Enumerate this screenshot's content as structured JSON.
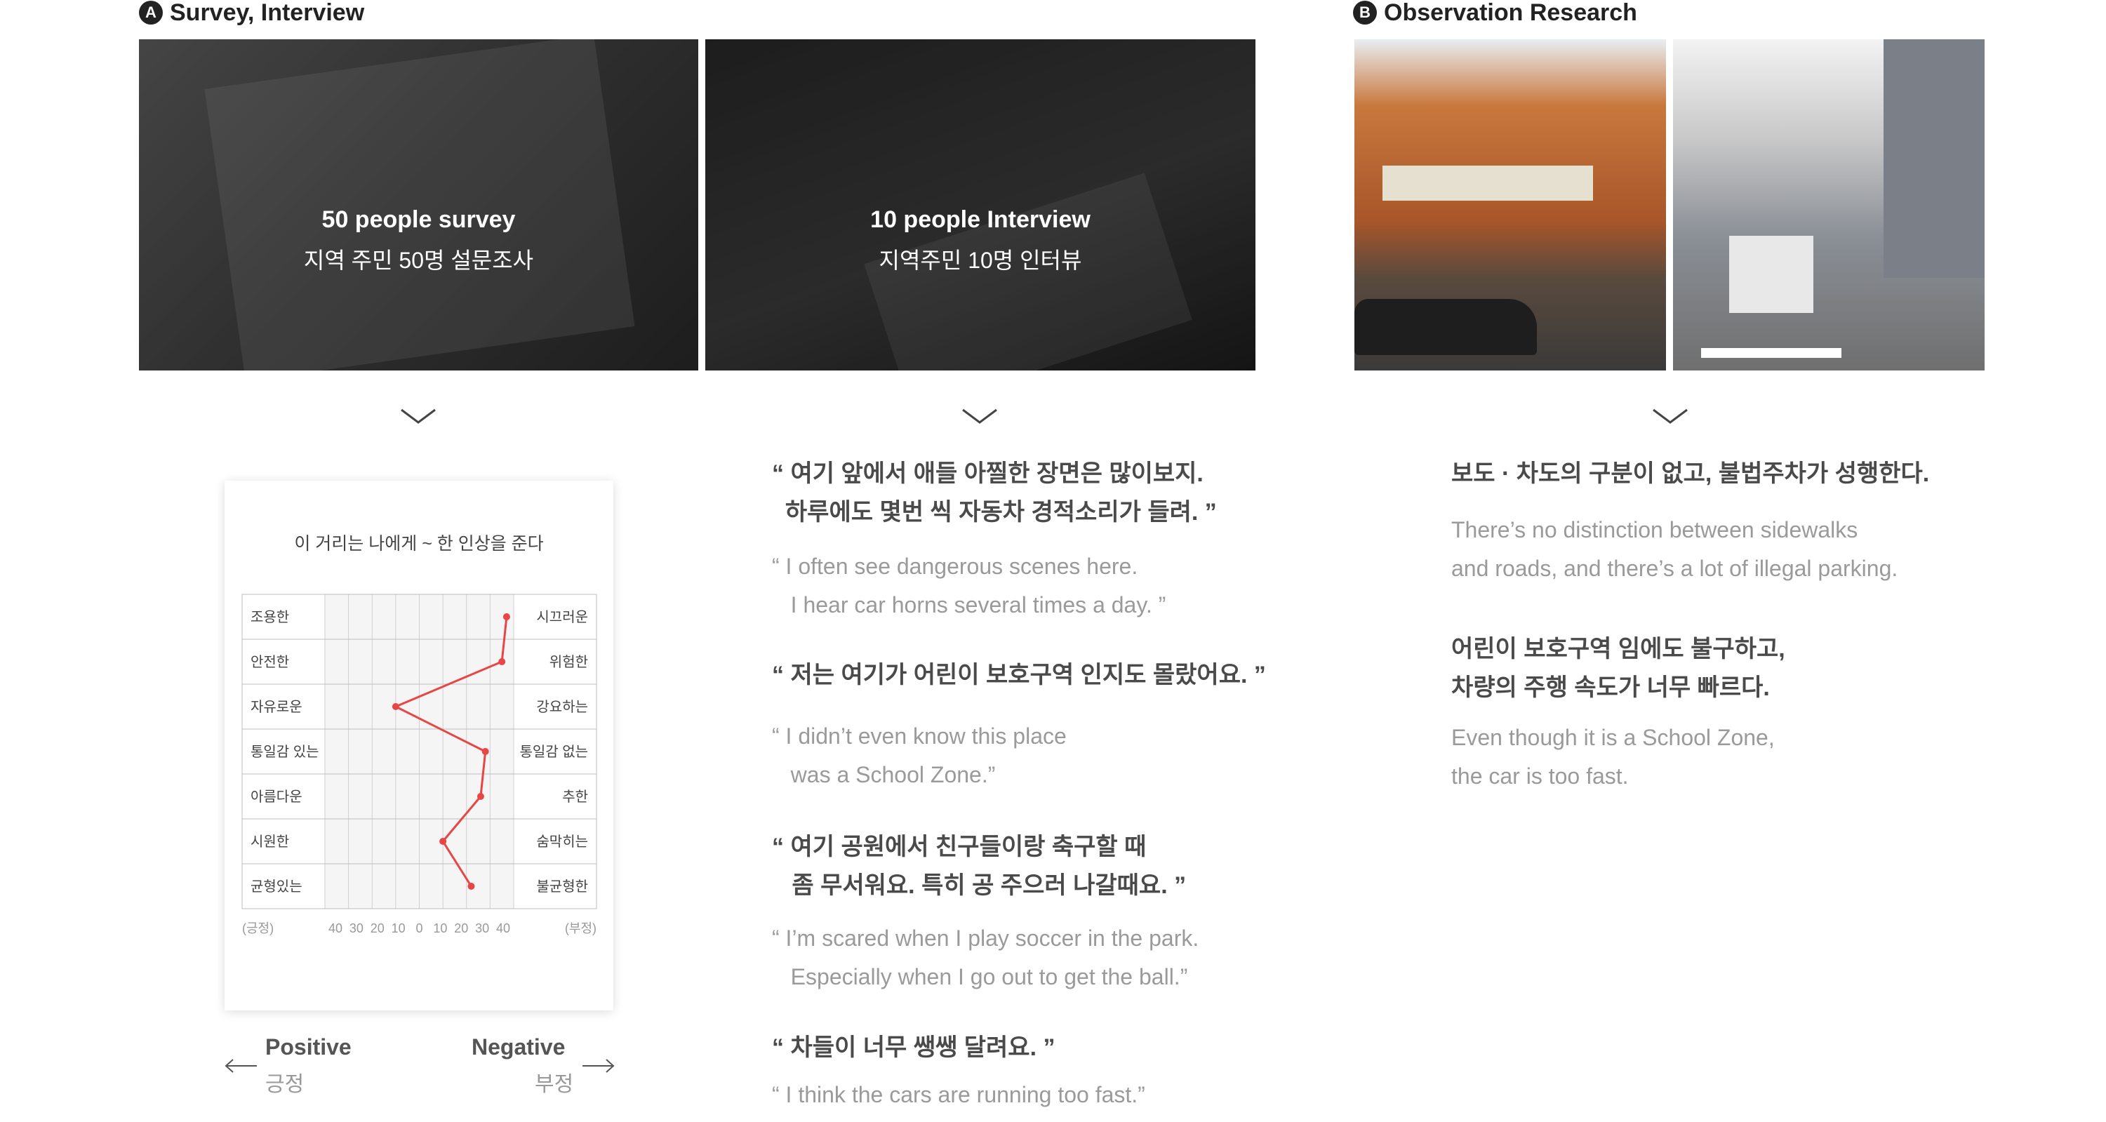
{
  "sectionA": {
    "badge": "A",
    "title": "Survey, Interview"
  },
  "sectionB": {
    "badge": "B",
    "title": "Observation Research"
  },
  "photos": {
    "survey": {
      "en": "50 people survey",
      "ko": "지역 주민 50명 설문조사"
    },
    "interview": {
      "en": "10 people Interview",
      "ko": "지역주민 10명 인터뷰"
    }
  },
  "chart_data": {
    "type": "line",
    "title": "이 거리는 나에게 ~ 한 인상을 준다",
    "left_labels": [
      "조용한",
      "안전한",
      "자유로운",
      "통일감 있는",
      "아름다운",
      "시원한",
      "균형있는"
    ],
    "right_labels": [
      "시끄러운",
      "위험한",
      "강요하는",
      "통일감 없는",
      "추한",
      "숨막히는",
      "불균형한"
    ],
    "x_ticks": [
      "40",
      "30",
      "20",
      "10",
      "0",
      "10",
      "20",
      "30",
      "40"
    ],
    "x_left_label": "(긍정)",
    "x_right_label": "(부정)",
    "xlim": [
      -40,
      40
    ],
    "values": [
      37,
      35,
      -10,
      28,
      26,
      10,
      22
    ],
    "line_color": "#e84545"
  },
  "legend": {
    "positive_en": "Positive",
    "positive_ko": "긍정",
    "negative_en": "Negative",
    "negative_ko": "부정"
  },
  "quotes": [
    {
      "ko": "“ 여기 앞에서 애들 아찔한 장면은 많이보지.\n  하루에도 몇번 씩 자동차 경적소리가 들려. ”",
      "en": "“ I often see dangerous scenes here.\n   I hear car horns several times a day. ”"
    },
    {
      "ko": "“ 저는 여기가 어린이 보호구역 인지도 몰랐어요. ”",
      "en": "“ I didn’t even know this place\n   was a School Zone.”"
    },
    {
      "ko": "“ 여기 공원에서 친구들이랑 축구할 때\n   좀 무서워요. 특히 공 주으러 나갈때요. ”",
      "en": "“ I’m scared when I play soccer in the park.\n   Especially when I go out to get the ball.”"
    },
    {
      "ko": "“ 차들이 너무 쌩쌩 달려요. ”",
      "en": "“ I think the cars are running too fast.”"
    }
  ],
  "observations": [
    {
      "ko": "보도 · 차도의 구분이 없고, 불법주차가 성행한다.",
      "en": "There’s no distinction between sidewalks\nand roads, and there’s a lot of illegal parking."
    },
    {
      "ko": "어린이 보호구역 임에도 불구하고,\n차량의 주행 속도가 너무 빠르다.",
      "en": "Even though it is a School Zone,\nthe car is too fast."
    }
  ]
}
